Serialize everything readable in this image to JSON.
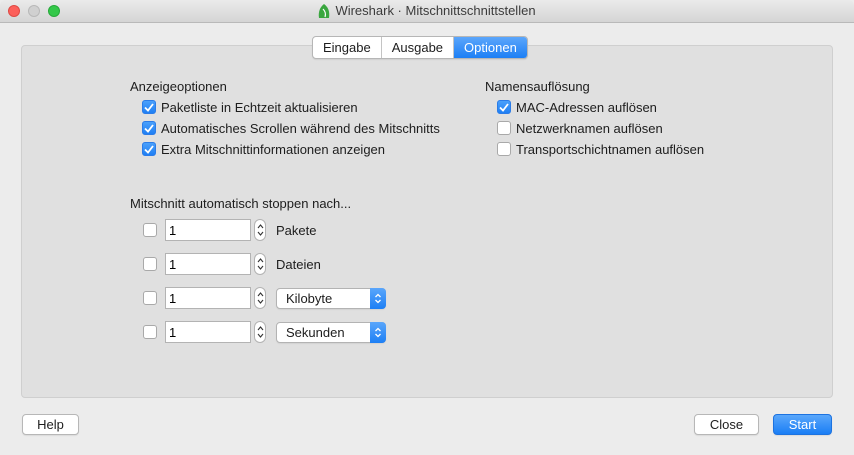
{
  "window": {
    "title": "Wireshark · Mitschnittschnittstellen",
    "app_icon": "wireshark-fin-icon"
  },
  "tabs": [
    {
      "label": "Eingabe",
      "active": false
    },
    {
      "label": "Ausgabe",
      "active": false
    },
    {
      "label": "Optionen",
      "active": true
    }
  ],
  "display_options": {
    "heading": "Anzeigeoptionen",
    "items": [
      {
        "label": "Paketliste in Echtzeit aktualisieren",
        "checked": true
      },
      {
        "label": "Automatisches Scrollen während des Mitschnitts",
        "checked": true
      },
      {
        "label": "Extra Mitschnittinformationen anzeigen",
        "checked": true
      }
    ]
  },
  "name_resolution": {
    "heading": "Namensauflösung",
    "items": [
      {
        "label": "MAC-Adressen auflösen",
        "checked": true
      },
      {
        "label": "Netzwerknamen auflösen",
        "checked": false
      },
      {
        "label": "Transportschichtnamen auflösen",
        "checked": false
      }
    ]
  },
  "auto_stop": {
    "heading": "Mitschnitt automatisch stoppen nach...",
    "rows": [
      {
        "checked": false,
        "value": "1",
        "unit": "Pakete"
      },
      {
        "checked": false,
        "value": "1",
        "unit": "Dateien"
      },
      {
        "checked": false,
        "value": "1",
        "unit": "Kilobyte",
        "is_select": true
      },
      {
        "checked": false,
        "value": "1",
        "unit": "Sekunden",
        "is_select": true
      }
    ]
  },
  "buttons": {
    "help": "Help",
    "close": "Close",
    "start": "Start"
  },
  "colors": {
    "accent": "#1c7ff5",
    "close_light": "#fc605b",
    "zoom_light": "#34c84a"
  }
}
